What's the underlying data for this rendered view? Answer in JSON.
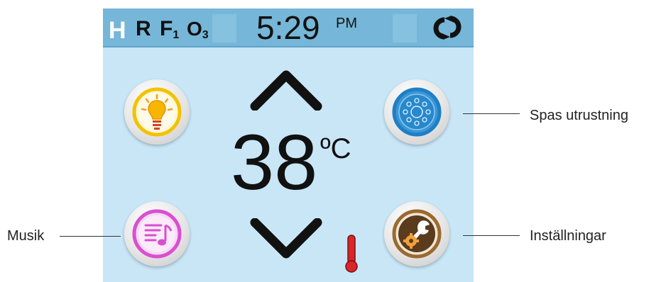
{
  "status_bar": {
    "indicator_h": "H",
    "indicator_r": "R",
    "indicator_f": "F",
    "indicator_f_sub": "1",
    "indicator_o": "O",
    "indicator_o_sub": "3",
    "time": "5:29",
    "ampm": "PM",
    "sync_icon": "sync-icon"
  },
  "temperature": {
    "value": "38",
    "unit": "ºC"
  },
  "buttons": {
    "light": {
      "icon": "lightbulb-icon"
    },
    "music": {
      "icon": "music-playlist-icon"
    },
    "equipment": {
      "icon": "jets-icon"
    },
    "settings": {
      "icon": "wrench-gear-icon"
    }
  },
  "callouts": {
    "equipment": "Spas utrustning",
    "music": "Musik",
    "settings": "Inställningar"
  },
  "colors": {
    "screen_bg": "#c9e6f6",
    "topbar_bg": "#76b6d8",
    "light_ring": "#f2c200",
    "music_ring": "#d94fd1",
    "equip_ring": "#1e7fc4",
    "settings_ring": "#9a6a2f",
    "thermo_red": "#d8262a"
  }
}
